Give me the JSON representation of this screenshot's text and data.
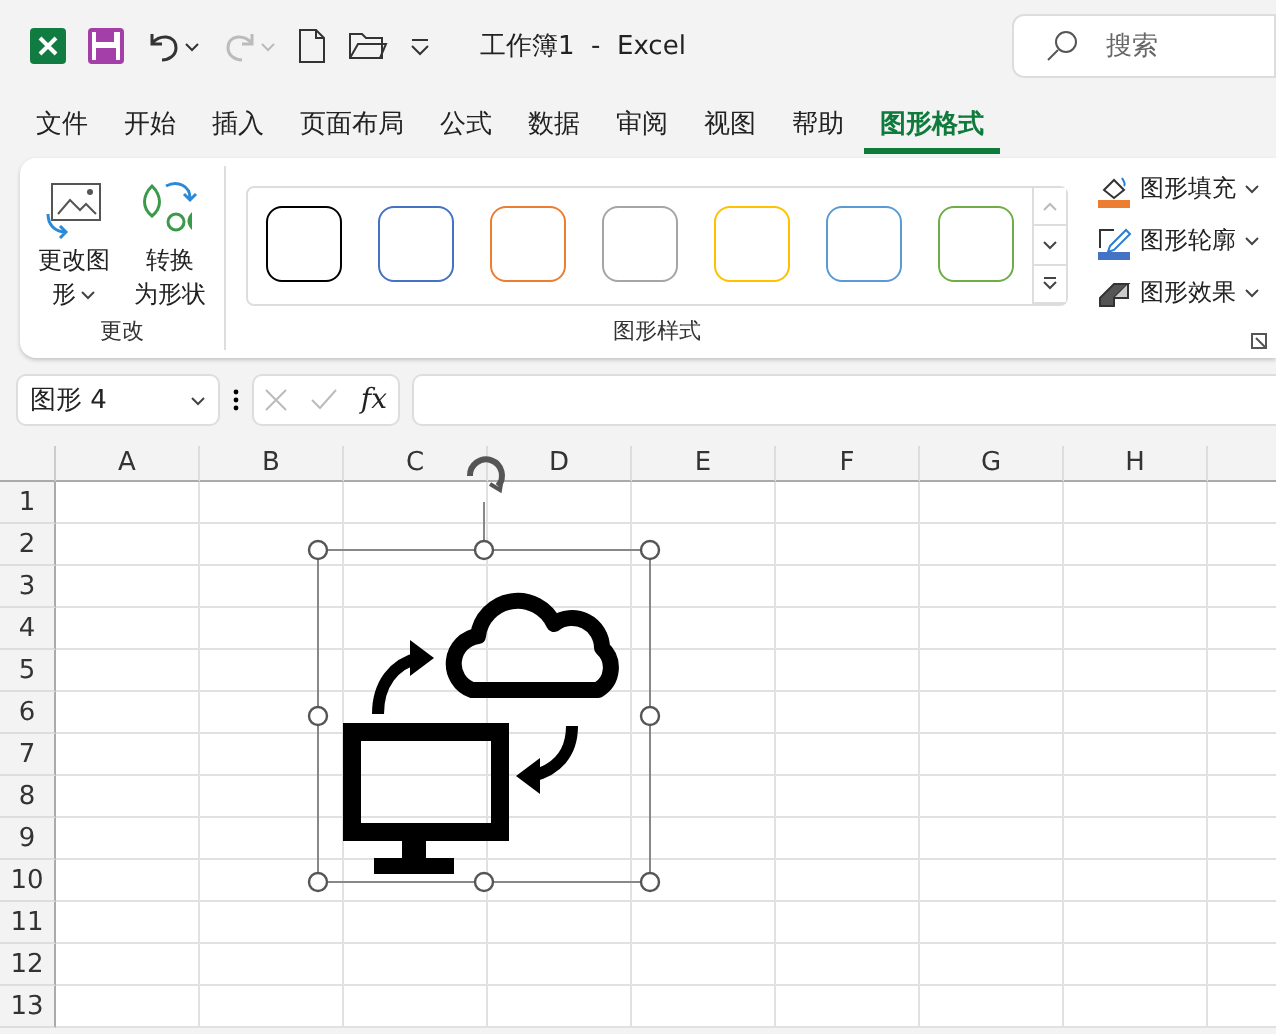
{
  "title_bar": {
    "title": "工作簿1  -  Excel",
    "search": {
      "placeholder": "搜索"
    }
  },
  "tabs": [
    {
      "label": "文件",
      "selected": false
    },
    {
      "label": "开始",
      "selected": false
    },
    {
      "label": "插入",
      "selected": false
    },
    {
      "label": "页面布局",
      "selected": false
    },
    {
      "label": "公式",
      "selected": false
    },
    {
      "label": "数据",
      "selected": false
    },
    {
      "label": "审阅",
      "selected": false
    },
    {
      "label": "视图",
      "selected": false
    },
    {
      "label": "帮助",
      "selected": false
    },
    {
      "label": "图形格式",
      "selected": true
    }
  ],
  "ribbon": {
    "change_group": {
      "label": "更改",
      "buttons": [
        {
          "kind": "edit",
          "lines": [
            "更改图",
            "形"
          ],
          "dropdown": true
        },
        {
          "kind": "convert",
          "lines": [
            "转换",
            "为形状"
          ],
          "dropdown": false
        }
      ]
    },
    "styles_group": {
      "label": "图形样式",
      "swatches": [
        {
          "color": "#000000"
        },
        {
          "color": "#4472c4"
        },
        {
          "color": "#ed7d31"
        },
        {
          "color": "#a5a5a5"
        },
        {
          "color": "#ffc000"
        },
        {
          "color": "#5b9bd5"
        },
        {
          "color": "#70ad47"
        }
      ]
    },
    "format_buttons": [
      {
        "kind": "fill",
        "label": "图形填充",
        "color": "#ed7d31"
      },
      {
        "kind": "outline",
        "label": "图形轮廓",
        "color": "#4472c4"
      },
      {
        "kind": "effects",
        "label": "图形效果"
      }
    ]
  },
  "formula_bar": {
    "name_box": "图形 4",
    "fx": "fx"
  },
  "sheet": {
    "columns": [
      "A",
      "B",
      "C",
      "D",
      "E",
      "F",
      "G",
      "H"
    ],
    "rows": [
      "1",
      "2",
      "3",
      "4",
      "5",
      "6",
      "7",
      "8",
      "9",
      "10",
      "11",
      "12",
      "13"
    ]
  }
}
